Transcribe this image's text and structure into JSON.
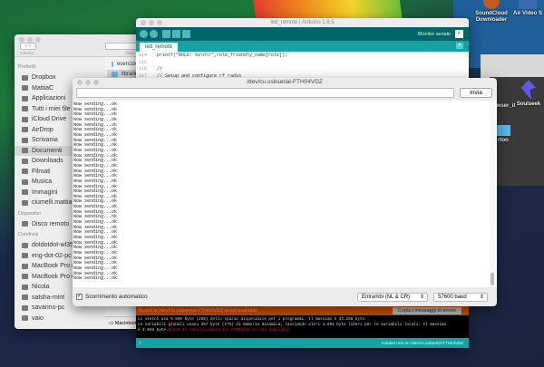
{
  "finder": {
    "back_label": "Indietro",
    "view_label": "Vista",
    "sections": [
      {
        "title": "Preferiti",
        "items": [
          "Dropbox",
          "MattiaC",
          "Applicazioni",
          "Tutti i miei file",
          "iCloud Drive",
          "AirDrop",
          "Scrivania",
          "Documenti",
          "Downloads",
          "Filmati",
          "Musica",
          "Immagini",
          "ciumelli.mattia"
        ]
      },
      {
        "title": "Dispositivi",
        "items": [
          "Disco remoto"
        ]
      },
      {
        "title": "Condivisi",
        "items": [
          "dotdotdot-wl352",
          "eng-dot-02-pc",
          "MacBook Pro di",
          "MacBook Pro di",
          "Nicola",
          "satsha-mint",
          "savarino-pc",
          "vaio"
        ]
      }
    ],
    "selected": "Documenti",
    "files": [
      "esercizio_n_2",
      "libraries"
    ],
    "path_item": "Macintosh HD"
  },
  "arduino": {
    "title": "led_remote | Arduino 1.6.5",
    "serial_monitor_label": "Monitor seriale",
    "tab": "led_remote",
    "code": [
      {
        "n": "114",
        "t": "  printf(\"ROLE: %s\\n\\r\",role_friendly_name[role]);"
      },
      {
        "n": "115",
        "t": ""
      },
      {
        "n": "116",
        "t": "  //"
      },
      {
        "n": "117",
        "t": "  // Setup and configure rf radio"
      }
    ],
    "error_bar": "Board at /dev/cu.usbserial-FTH04VDZ is not available",
    "copy_errors_label": "Copia i messaggi di errore",
    "console": [
      "Lo sketch usa 9.060 byte (28%) dello spazio disponibile per i programmi. Il massimo è 32.256 byte.",
      "Le variabili globali usano 357 byte (17%) di memoria dinamica, lasciando altri 1.691 byte liberi per le variabili locali. Il massimo",
      "è 2.048 byte."
    ],
    "console_error": "Board at /dev/cu.usbserial-FTH04VDZ is not available",
    "status_line": "7",
    "status_board": "Arduino Uno on /dev/cu.usbserial-FTH04VDZ"
  },
  "serial": {
    "title": "/dev/cu.usbserial-FTH04VDZ",
    "input_value": "",
    "send_label": "Invia",
    "autoscroll_label": "Scorrimento automatico",
    "autoscroll": true,
    "line_ending": "Entrambi (NL & CR)",
    "baud": "57600 baud",
    "lines": [
      "Now sending...ok",
      "Now sending...ok",
      "Now sending...ok",
      "Now sending...ok",
      "Now sending...ok",
      "Now sending...ok",
      "Now sending...ok",
      "Now sending...ok",
      "Now sending...ok",
      "Now sending...ok",
      "Now sending...ok",
      "Now sending...ok",
      "Now sending...ok",
      "Now sending...ok",
      "Now sending...ok",
      "Now sending...ok",
      "Now sending...ok",
      "Now sending...ok",
      "Now sending...ok",
      "Now sending...ok",
      "Now sending...ok",
      "Now sending...ok",
      "Now sending...ok",
      "Now sending...ok",
      "Now sending...ok",
      "Now sending...ok",
      "Now sending...ok",
      "Now sending...ok",
      "Now sending...ok",
      "Now sending...ok",
      "Now sending...ok",
      "Now sending...ok",
      "Now sending...ok",
      "Now sending...ok",
      "Now sending...ok"
    ]
  },
  "desktop": {
    "icons": [
      "SoundCloud Downloader",
      "Air Video S",
      "rowser_it",
      "Soulseek",
      "rton"
    ]
  }
}
